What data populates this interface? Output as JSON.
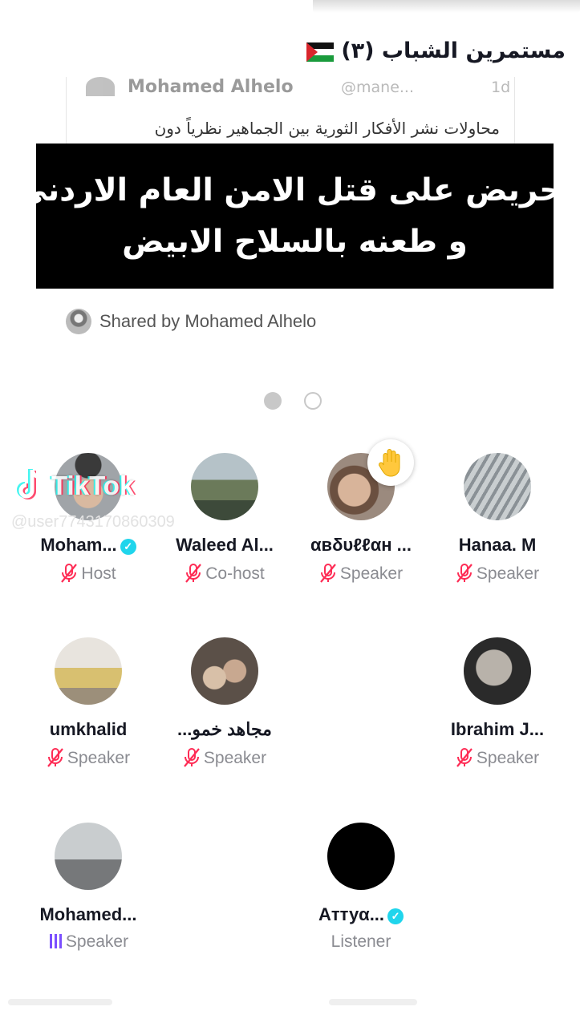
{
  "header": {
    "room_title": "مستمرين الشباب (٣)",
    "flag_icon": "palestine-flag-icon"
  },
  "tweet": {
    "author": "Mohamed Alhelo",
    "handle": "@mane...",
    "time": "1d",
    "text": "محاولات نشر الأفكار الثورية بين الجماهير نظرياً دون"
  },
  "overlay": {
    "line1": "تحريض على قتل الامن العام الاردني",
    "line2": "و طعنه بالسلاح الابيض"
  },
  "shared_by": "Shared by Mohamed Alhelo",
  "watermark": {
    "logo": "TikTok",
    "user": "@user7743170860309"
  },
  "participants": [
    {
      "name": "Moham...",
      "role": "Host",
      "verified": true,
      "mic": "muted"
    },
    {
      "name": "Waleed Al...",
      "role": "Co-host",
      "verified": false,
      "mic": "muted"
    },
    {
      "name": " αвδυℓℓαн ...",
      "role": "Speaker",
      "verified": false,
      "mic": "muted",
      "hand_raised": true
    },
    {
      "name": "Hanaa. M",
      "role": "Speaker",
      "verified": false,
      "mic": "muted"
    },
    {
      "name": "umkhalid",
      "role": "Speaker",
      "verified": false,
      "mic": "muted"
    },
    {
      "name": "مجاهد خمو...",
      "role": "Speaker",
      "verified": false,
      "mic": "muted"
    },
    {
      "name": "Ibrahim J...",
      "role": "Speaker",
      "verified": false,
      "mic": "muted"
    },
    {
      "name": "Mohamed...",
      "role": "Speaker",
      "verified": false,
      "mic": "speaking"
    },
    {
      "name": "Aттуα...",
      "role": "Listener",
      "verified": true,
      "mic": "none"
    }
  ],
  "colors": {
    "accent": "#fe2c55",
    "verified": "#20d5ec",
    "speaking": "#7b4fff"
  }
}
